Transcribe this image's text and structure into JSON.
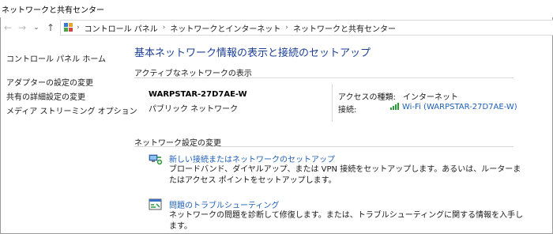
{
  "window": {
    "title": "ネットワークと共有センター"
  },
  "nav": {
    "back_glyph": "←",
    "forward_glyph": "→",
    "dropdown_glyph": "⌄",
    "up_glyph": "↑",
    "breadcrumbs": [
      "コントロール パネル",
      "ネットワークとインターネット",
      "ネットワークと共有センター"
    ],
    "separator": "›"
  },
  "sidebar": {
    "items": [
      {
        "label": "コントロール パネル ホーム"
      },
      {
        "label": "アダプターの設定の変更"
      },
      {
        "label": "共有の詳細設定の変更"
      },
      {
        "label": "メディア ストリーミング オプション"
      }
    ]
  },
  "main": {
    "heading": "基本ネットワーク情報の表示と接続のセットアップ",
    "active_networks_label": "アクティブなネットワークの表示",
    "network": {
      "name": "WARPSTAR-27D7AE-W",
      "type": "パブリック ネットワーク",
      "access_type_label": "アクセスの種類:",
      "access_type_value": "インターネット",
      "connection_label": "接続:",
      "connection_value": "Wi-Fi (WARPSTAR-27D7AE-W)"
    },
    "change_settings_label": "ネットワーク設定の変更",
    "tasks": [
      {
        "icon": "new-connection-icon",
        "link": "新しい接続またはネットワークのセットアップ",
        "desc": "ブロードバンド、ダイヤルアップ、または VPN 接続をセットアップします。あるいは、ルーターまたはアクセス ポイントをセットアップします。"
      },
      {
        "icon": "troubleshoot-icon",
        "link": "問題のトラブルシューティング",
        "desc": "ネットワークの問題を診断して修復します。または、トラブルシューティングに関する情報を入手します。"
      }
    ]
  },
  "colors": {
    "heading": "#1c3f95",
    "link": "#1c5fb8",
    "signal": "#2a9a3a"
  }
}
